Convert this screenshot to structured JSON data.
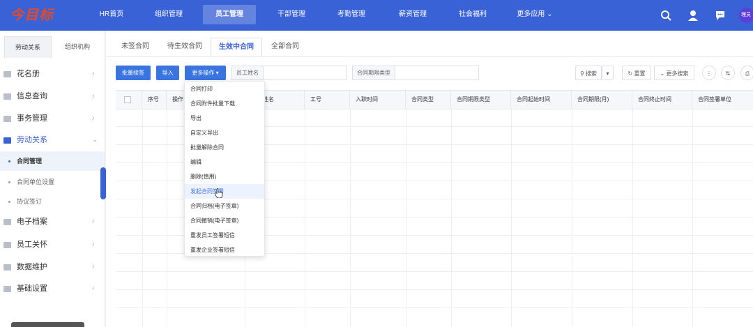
{
  "brand": {
    "logo_text": "今目标"
  },
  "nav": {
    "items": [
      "HR首页",
      "组织管理",
      "员工管理",
      "干部管理",
      "考勤管理",
      "薪资管理",
      "社会福利",
      "更多应用"
    ],
    "active_index": 2,
    "more_chevron": "chevron-down-icon"
  },
  "header_icons": [
    "search-icon",
    "user-icon",
    "chat-icon"
  ],
  "user": {
    "avatar_text": "理员"
  },
  "sidebar": {
    "tabs": [
      "劳动关系",
      "组织机构"
    ],
    "active_tab": 0,
    "menu": [
      {
        "label": "花名册",
        "icon": "roster-icon"
      },
      {
        "label": "信息查询",
        "icon": "info-query-icon"
      },
      {
        "label": "事务管理",
        "icon": "affairs-icon"
      },
      {
        "label": "劳动关系",
        "icon": "labor-relations-icon",
        "open": true
      },
      {
        "label": "电子档案",
        "icon": "e-archive-icon"
      },
      {
        "label": "员工关怀",
        "icon": "employee-care-icon"
      },
      {
        "label": "数据维护",
        "icon": "data-maintenance-icon"
      },
      {
        "label": "基础设置",
        "icon": "basic-settings-icon"
      }
    ],
    "submenu": [
      "合同管理",
      "合同单位设置",
      "协议签订"
    ],
    "active_sub": 0
  },
  "content_tabs": {
    "items": [
      "未签合同",
      "待生效合同",
      "生效中合同",
      "全部合同"
    ],
    "active_index": 2
  },
  "toolbar": {
    "batch_renew": "批量续签",
    "import": "导入",
    "more_actions": "更多操作",
    "employee_name_label": "员工姓名",
    "employee_name_value": "",
    "contract_term_type_label": "合同期限类型",
    "contract_term_type_value": "",
    "search": "搜索",
    "reset": "重置",
    "more_search": "更多搜索"
  },
  "table": {
    "columns": [
      "序号",
      "操作",
      "姓名",
      "工号",
      "入职时间",
      "合同类型",
      "合同期限类型",
      "合同起始时间",
      "合同期限(月)",
      "合同终止时间",
      "合同签署单位"
    ],
    "rows": []
  },
  "dropdown": {
    "items": [
      "合同打印",
      "合同附件批量下载",
      "导出",
      "自定义导出",
      "批量解除合同",
      "编辑",
      "删除(慎用)",
      "发起合同签署",
      "合同归档(电子签章)",
      "合同撤销(电子签章)",
      "重发员工签署短信",
      "重发企业签署短信"
    ],
    "hover_index": 7
  },
  "colors": {
    "primary": "#3a62d7",
    "button": "#3a74e0",
    "logo": "#e24a2b",
    "avatar": "#5b3fd8"
  }
}
